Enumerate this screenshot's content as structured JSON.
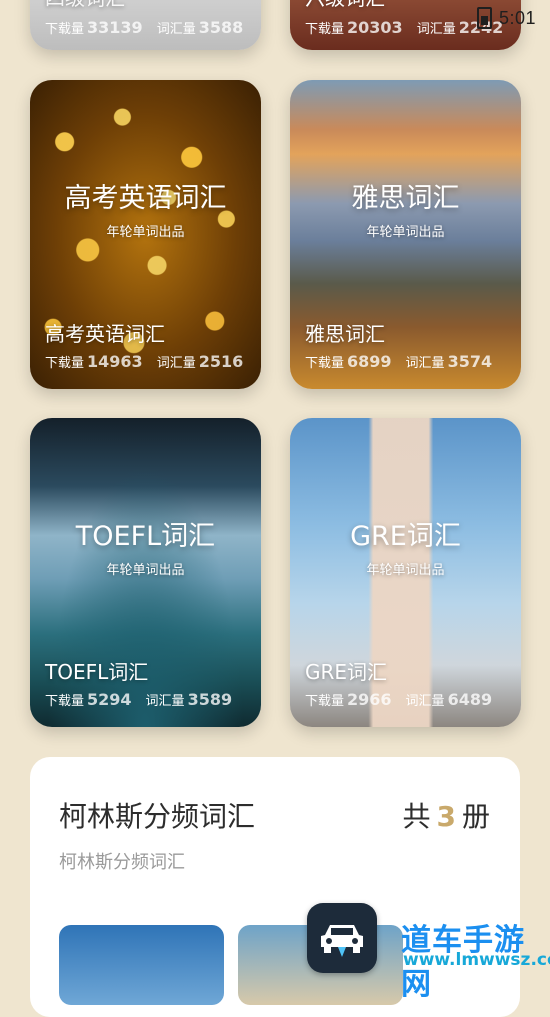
{
  "status_bar": {
    "time": "5:01"
  },
  "top_row": [
    {
      "name_partial": "四级词汇",
      "download_label": "下载量",
      "downloads": "33139",
      "vocab_label": "词汇量",
      "vocab": "3588"
    },
    {
      "name_partial": "六级词汇",
      "download_label": "下载量",
      "downloads": "20303",
      "vocab_label": "词汇量",
      "vocab": "2242"
    }
  ],
  "cards": [
    {
      "title": "高考英语词汇",
      "subtitle": "年轮单词出品",
      "name": "高考英语词汇",
      "download_label": "下载量",
      "downloads": "14963",
      "vocab_label": "词汇量",
      "vocab": "2516"
    },
    {
      "title": "雅思词汇",
      "subtitle": "年轮单词出品",
      "name": "雅思词汇",
      "download_label": "下载量",
      "downloads": "6899",
      "vocab_label": "词汇量",
      "vocab": "3574"
    },
    {
      "title": "TOEFL词汇",
      "subtitle": "年轮单词出品",
      "name": "TOEFL词汇",
      "download_label": "下载量",
      "downloads": "5294",
      "vocab_label": "词汇量",
      "vocab": "3589"
    },
    {
      "title": "GRE词汇",
      "subtitle": "年轮单词出品",
      "name": "GRE词汇",
      "download_label": "下载量",
      "downloads": "2966",
      "vocab_label": "词汇量",
      "vocab": "6489"
    }
  ],
  "collins": {
    "title": "柯林斯分频词汇",
    "count_prefix": "共",
    "count": "3",
    "count_suffix": "册",
    "subtitle": "柯林斯分频词汇"
  },
  "watermark": {
    "text": "道车手游网",
    "url": "www.lmwwsz.com"
  }
}
